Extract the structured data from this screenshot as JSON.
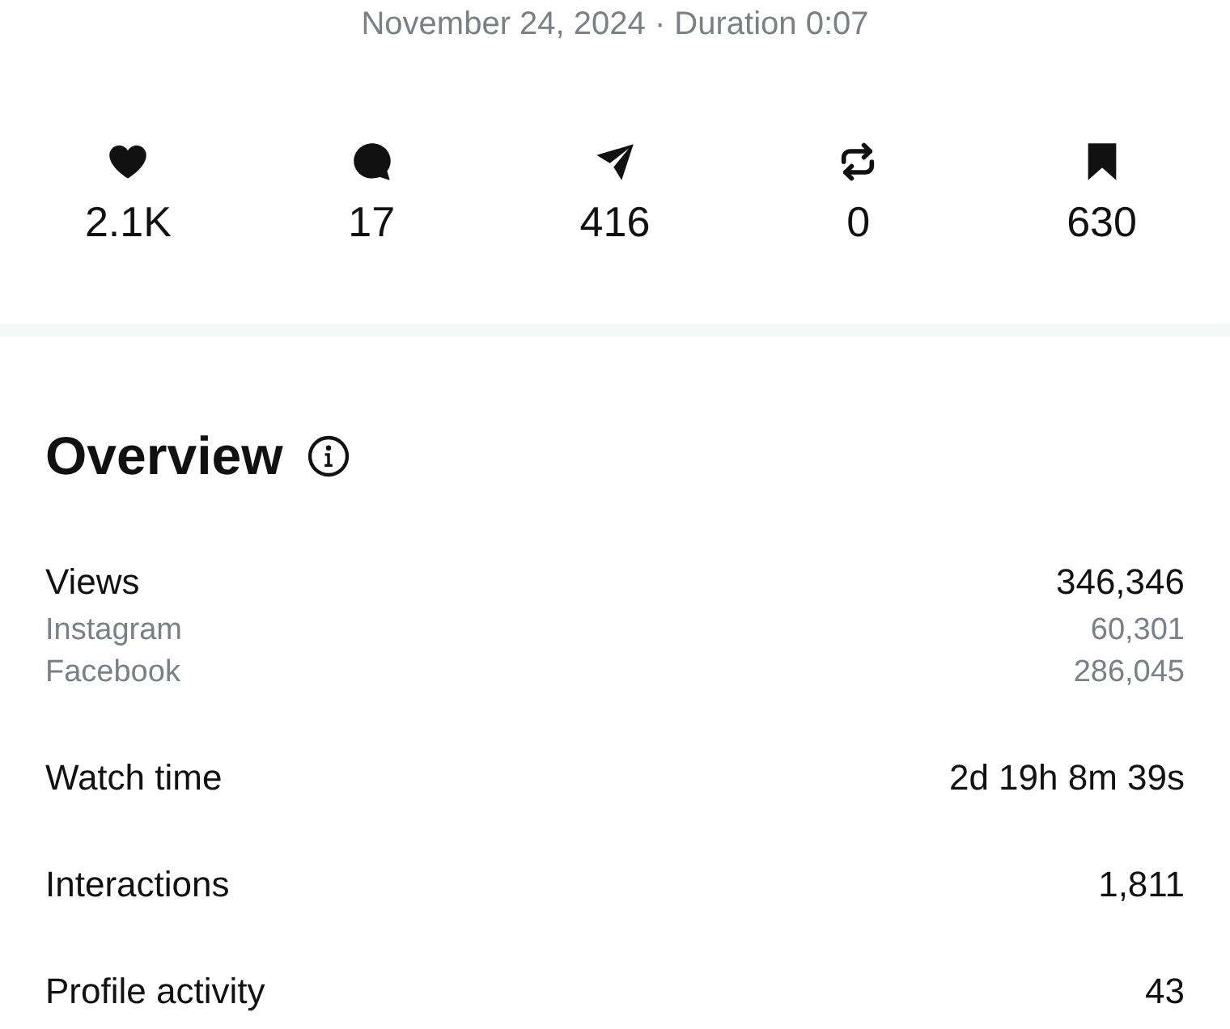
{
  "header": {
    "subtitle": "November 24, 2024 · Duration 0:07"
  },
  "stats": [
    {
      "kind": "likes",
      "value": "2.1K"
    },
    {
      "kind": "comments",
      "value": "17"
    },
    {
      "kind": "shares",
      "value": "416"
    },
    {
      "kind": "reposts",
      "value": "0"
    },
    {
      "kind": "saves",
      "value": "630"
    }
  ],
  "overview": {
    "title": "Overview",
    "metrics": [
      {
        "label": "Views",
        "value": "346,346",
        "breakdown": [
          {
            "label": "Instagram",
            "value": "60,301"
          },
          {
            "label": "Facebook",
            "value": "286,045"
          }
        ]
      },
      {
        "label": "Watch time",
        "value": "2d 19h 8m 39s"
      },
      {
        "label": "Interactions",
        "value": "1,811"
      },
      {
        "label": "Profile activity",
        "value": "43"
      }
    ]
  }
}
